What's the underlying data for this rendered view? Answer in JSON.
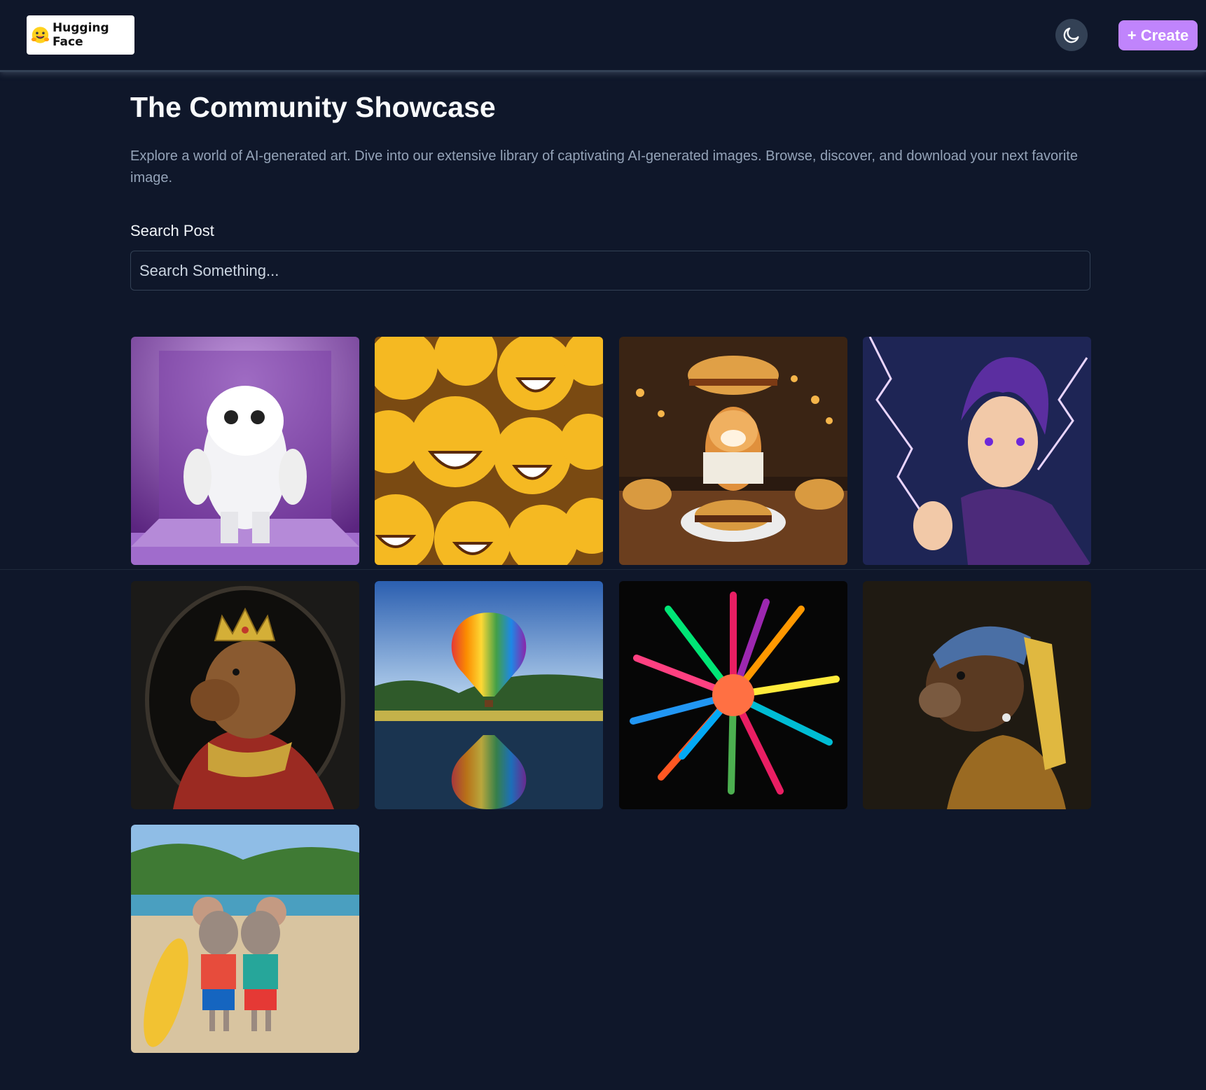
{
  "header": {
    "logo_text": "Hugging Face",
    "logo_icon": "hugging-face-emoji",
    "theme_toggle_icon": "moon-icon",
    "create_label": "+ Create"
  },
  "main": {
    "title": "The Community Showcase",
    "description": "Explore a world of AI-generated art. Dive into our extensive library of captivating AI-generated images. Browse, discover, and download your next favorite image.",
    "search": {
      "label": "Search Post",
      "placeholder": "Search Something..."
    }
  },
  "gallery": [
    {
      "subject": "white fluffy monster"
    },
    {
      "subject": "laughing emojis"
    },
    {
      "subject": "shiba dog with burgers"
    },
    {
      "subject": "anime boy with lightning"
    },
    {
      "subject": "capybara king"
    },
    {
      "subject": "hot air balloon over lake"
    },
    {
      "subject": "color powder explosion"
    },
    {
      "subject": "otter with pearl earring"
    },
    {
      "subject": "surfing mice on beach"
    }
  ],
  "colors": {
    "background": "#0f172a",
    "accent": "#c084fc",
    "muted_text": "#94a3b8",
    "border": "#334155"
  }
}
